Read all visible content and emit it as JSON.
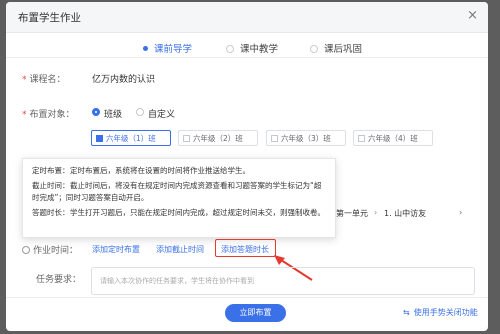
{
  "dialog": {
    "title": "布置学生作业",
    "close_icon": "×"
  },
  "steps": [
    {
      "label": "课前导学",
      "active": true
    },
    {
      "label": "课中教学",
      "active": false
    },
    {
      "label": "课后巩固",
      "active": false
    }
  ],
  "form": {
    "course_label": "课程名：",
    "course_value": "亿万内数的认识",
    "target_label": "布置对象：",
    "target_options": [
      "班级",
      "自定义"
    ],
    "classes": [
      {
        "label": "六年级（1）班",
        "checked": true
      },
      {
        "label": "六年级（2）班",
        "checked": false
      },
      {
        "label": "六年级（3）班",
        "checked": false
      },
      {
        "label": "六年级（4）班",
        "checked": false
      }
    ],
    "chapter_partial": "第一单元",
    "chapter_lesson": "1. 山中访友",
    "time_label": "作业时间：",
    "time_links": [
      "添加定时布置",
      "添加截止时间",
      "添加答题时长"
    ],
    "requirement_label": "任务要求：",
    "requirement_placeholder": "请输入本次协作的任务要求，学生将在协作中看到"
  },
  "tooltip": [
    {
      "key": "定时布置：",
      "value": "定时布置后，系统将在设置的时间将作业推送给学生。"
    },
    {
      "key": "截止时间：",
      "value": "截止时间后，将没有在规定时间内完成资源查看和习题答案的学生标记为“超时完成”；同时习题答案自动开启。"
    },
    {
      "key": "答题时长：",
      "value": "学生打开习题后，只能在规定时间内完成，超过规定时间未交，则强制收卷。"
    }
  ],
  "footer": {
    "submit_label": "立即布置",
    "function_link": "使用手势关闭功能"
  }
}
